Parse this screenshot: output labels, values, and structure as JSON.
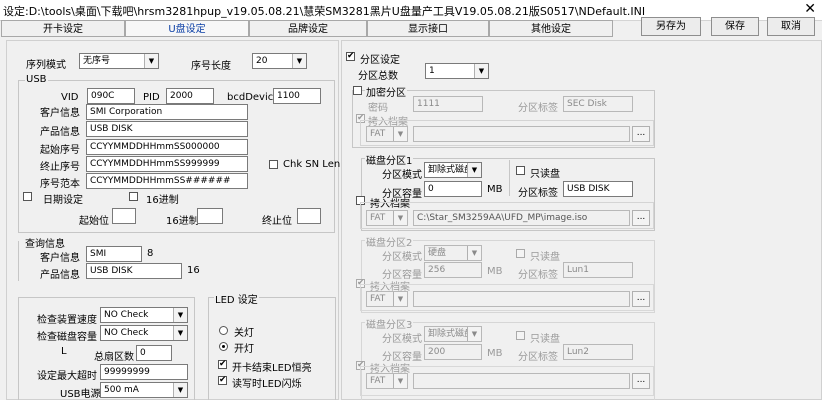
{
  "window": {
    "title": "设定:D:\\tools\\桌面\\下载吧\\hrsm3281hpup_v19.05.08.21\\慧荣SM3281黑片U盘量产工具V19.05.08.21版S0517\\NDefault.INI",
    "close": "✕"
  },
  "tabs": [
    "开卡设定",
    "U盘设定",
    "品牌设定",
    "显示接口",
    "其他设定"
  ],
  "toolbar": {
    "save_as": "另存为",
    "save": "保存",
    "cancel": "取消"
  },
  "serial": {
    "mode_label": "序列模式",
    "mode_value": "无序号",
    "length_label": "序号长度",
    "length_value": "20"
  },
  "usb": {
    "group": "USB",
    "vid_label": "VID",
    "vid_value": "090C",
    "pid_label": "PID",
    "pid_value": "2000",
    "bcd_label": "bcdDevice",
    "bcd_value": "1100",
    "customer_label": "客户信息",
    "customer_value": "SMI Corporation",
    "product_label": "产品信息",
    "product_value": "USB DISK",
    "start_label": "起始序号",
    "start_value": "CCYYMMDDHHmmSS000000",
    "end_label": "终止序号",
    "end_value": "CCYYMMDDHHmmSS999999",
    "sample_label": "序号范本",
    "sample_value": "CCYYMMDDHHmmSS######",
    "chk_sn_len": "Chk SN Len",
    "date_label": "日期设定",
    "hex_label": "16进制",
    "start_pos": "起始位",
    "hex2": "16进制",
    "end_pos": "终止位"
  },
  "query": {
    "group": "查询信息",
    "customer_label": "客户信息",
    "customer_value": "SMI",
    "customer_len": "8",
    "product_label": "产品信息",
    "product_value": "USB DISK",
    "product_len": "16"
  },
  "misc": {
    "speed_label": "检查装置速度",
    "speed_value": "NO Check",
    "capacity_label": "检查磁盘容量",
    "capacity_value": "NO Check",
    "l_label": "L",
    "bad_label": "总扇区数",
    "bad_value": "0",
    "timeout_label": "设定最大超时",
    "timeout_value": "99999999",
    "power_label": "USB电源",
    "power_value": "500 mA"
  },
  "led": {
    "group": "LED 设定",
    "off": "关灯",
    "on": "开灯",
    "end_bright": "开卡结束LED恒亮",
    "rw_blink": "读写时LED闪烁"
  },
  "partition": {
    "enable": "分区设定",
    "count_label": "分区总数",
    "count_value": "1",
    "encrypt": "加密分区",
    "pwd_label": "密码",
    "pwd_value": "1111",
    "tag_label": "分区标签",
    "tag_value": "SEC Disk",
    "copy": "拷入档案",
    "fs": "FAT"
  },
  "disks": [
    {
      "group": "磁盘分区1",
      "mode_label": "分区模式",
      "mode_value": "卸除式磁盘",
      "readonly": "只读盘",
      "cap_label": "分区容量",
      "cap_value": "0",
      "unit": "MB",
      "tag_label": "分区标签",
      "tag_value": "USB DISK",
      "copy": "拷入档案",
      "fs": "FAT",
      "path": "C:\\Star_SM3259AA\\UFD_MP\\image.iso"
    },
    {
      "group": "磁盘分区2",
      "mode_label": "分区模式",
      "mode_value": "硬盘",
      "readonly": "只读盘",
      "cap_label": "分区容量",
      "cap_value": "256",
      "unit": "MB",
      "tag_label": "分区标签",
      "tag_value": "Lun1",
      "copy": "拷入档案",
      "fs": "FAT",
      "path": ""
    },
    {
      "group": "磁盘分区3",
      "mode_label": "分区模式",
      "mode_value": "卸除式磁盘",
      "readonly": "只读盘",
      "cap_label": "分区容量",
      "cap_value": "200",
      "unit": "MB",
      "tag_label": "分区标签",
      "tag_value": "Lun2",
      "copy": "拷入档案",
      "fs": "FAT",
      "path": ""
    }
  ],
  "icons": {
    "check": "✔",
    "arrow": "▼",
    "dots": "..."
  }
}
